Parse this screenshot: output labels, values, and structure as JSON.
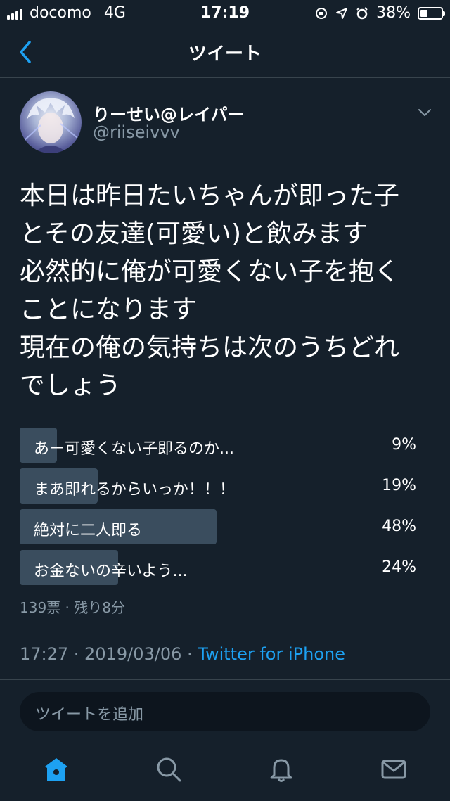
{
  "status_bar": {
    "carrier": "docomo",
    "network": "4G",
    "time": "17:19",
    "battery": "38%"
  },
  "nav": {
    "title": "ツイート"
  },
  "tweet": {
    "display_name": "りーせい@レイパー",
    "handle": "@riiseivvv",
    "text": "本日は昨日たいちゃんが即った子\nとその友達(可愛い)と飲みます\n必然的に俺が可愛くない子を抱く\nことになります\n現在の俺の気持ちは次のうちどれ\nでしょう",
    "poll": {
      "options": [
        {
          "label": "あー可愛くない子即るのか...",
          "percent": "9%",
          "value": 9
        },
        {
          "label": "まあ即れるからいっか！！！",
          "percent": "19%",
          "value": 19
        },
        {
          "label": "絶対に二人即る",
          "percent": "48%",
          "value": 48
        },
        {
          "label": "お金ないの辛いよう...",
          "percent": "24%",
          "value": 24
        }
      ],
      "meta": "139票 · 残り8分"
    },
    "timestamp": "17:27 · 2019/03/06 · ",
    "source": "Twitter for iPhone"
  },
  "compose": {
    "placeholder": "ツイートを追加"
  },
  "tabbar": {
    "items": [
      "home-icon",
      "search-icon",
      "notifications-icon",
      "messages-icon"
    ]
  },
  "colors": {
    "background": "#15202b",
    "accent": "#1da1f2",
    "muted": "#8899a6",
    "poll_bar": "#3a4d5e"
  }
}
